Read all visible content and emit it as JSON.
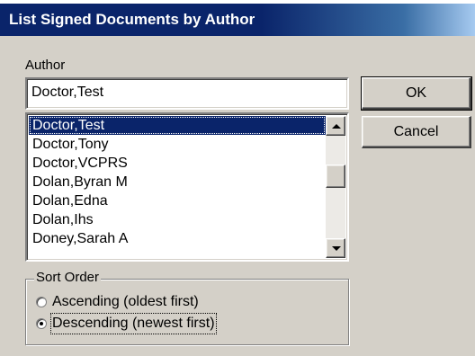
{
  "dialog": {
    "title": "List Signed Documents by Author"
  },
  "author": {
    "label": "Author",
    "value": "Doctor,Test",
    "items": [
      "Doctor,Test",
      "Doctor,Tony",
      "Doctor,VCPRS",
      "Dolan,Byran M",
      "Dolan,Edna",
      "Dolan,Ihs",
      "Doney,Sarah A"
    ],
    "selected_index": 0
  },
  "buttons": {
    "ok": "OK",
    "cancel": "Cancel"
  },
  "sort_order": {
    "label": "Sort Order",
    "options": [
      "Ascending (oldest first)",
      "Descending (newest first)"
    ],
    "selected_index": 1
  }
}
